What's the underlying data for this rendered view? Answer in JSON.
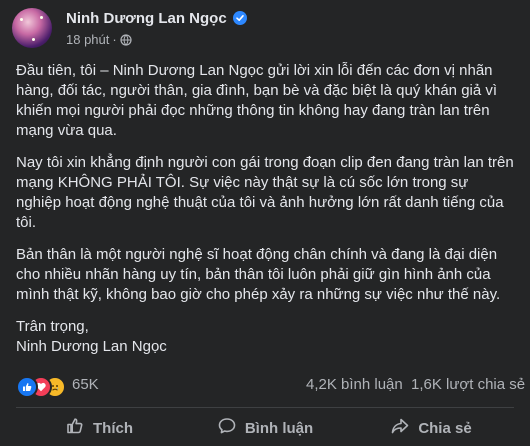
{
  "post": {
    "author": "Ninh Dương Lan Ngọc",
    "time": "18 phút",
    "separator": "·",
    "paragraphs": [
      "Đầu tiên, tôi – Ninh Dương Lan Ngọc gửi lời xin lỗi đến các đơn vị nhãn hàng, đối tác, người thân, gia đình, bạn bè và đặc biệt là quý khán giả vì khiến mọi người phải đọc những thông tin không hay đang tràn lan trên mạng vừa qua.",
      "Nay tôi xin khẳng định người con gái trong đoạn clip đen đang tràn lan trên mạng KHÔNG PHẢI TÔI. Sự việc này thật sự là cú sốc lớn trong sự nghiệp hoạt động nghệ thuật của tôi và ảnh hưởng lớn rất danh tiếng của tôi.",
      "Bản thân là một người nghệ sĩ hoạt động chân chính và đang là đại diện cho nhiều nhãn hàng uy tín, bản thân tôi luôn phải giữ gìn hình ảnh của mình thật kỹ, không bao giờ cho phép xảy ra những sự việc như thế này."
    ],
    "closing": "Trân trọng,",
    "signature": "Ninh Dương Lan Ngọc"
  },
  "stats": {
    "reactions_count": "65K",
    "reaction_icons": [
      "like-icon",
      "love-icon",
      "sad-icon"
    ],
    "comments": "4,2K bình luận",
    "shares": "1,6K lượt chia sẻ"
  },
  "actions": {
    "like": "Thích",
    "comment": "Bình luận",
    "share": "Chia sẻ"
  },
  "colors": {
    "background": "#242526",
    "text": "#e4e6eb",
    "muted": "#b0b3b8",
    "verified": "#2d88ff",
    "like": "#1877f2",
    "love": "#f33e58",
    "sad": "#f7b928"
  }
}
